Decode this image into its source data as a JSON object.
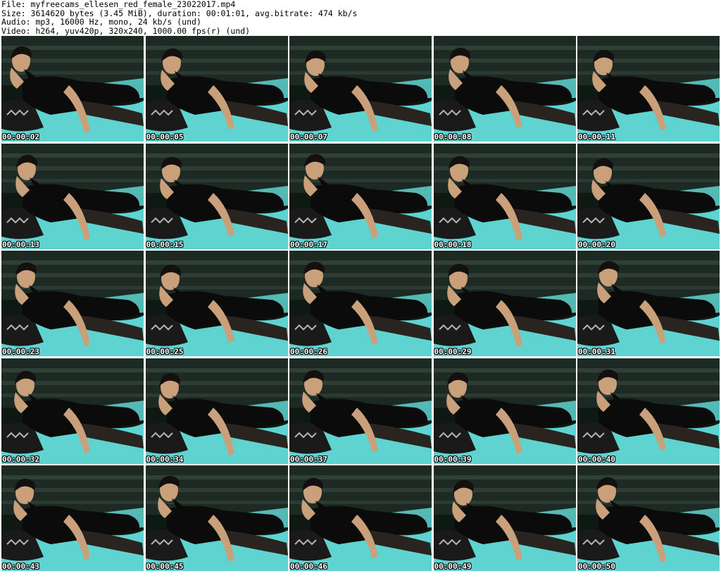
{
  "header": {
    "file_line": "File: myfreecams_ellesen_red_female_23022017.mp4",
    "size_line": "Size: 3614620 bytes (3.45 MiB), duration: 00:01:01, avg.bitrate: 474 kb/s",
    "audio_line": "Audio: mp3, 16000 Hz, mono, 24 kb/s (und)",
    "video_line": "Video: h264, yuv420p, 320x240, 1000.00 fps(r) (und)"
  },
  "colors": {
    "sheet": "#5fd3d0",
    "headboard": "#1d2a24",
    "slat": "#3a4a40",
    "dress": "#0b0b0b",
    "skin": "#c9a07a",
    "hair": "#141010",
    "stocking": "#2a2420",
    "pillow": "#1a1a1a"
  },
  "frames": [
    {
      "timestamp": "00:00:02"
    },
    {
      "timestamp": "00:00:05"
    },
    {
      "timestamp": "00:00:07"
    },
    {
      "timestamp": "00:00:08"
    },
    {
      "timestamp": "00:00:11"
    },
    {
      "timestamp": "00:00:13"
    },
    {
      "timestamp": "00:00:15"
    },
    {
      "timestamp": "00:00:17"
    },
    {
      "timestamp": "00:00:18"
    },
    {
      "timestamp": "00:00:20"
    },
    {
      "timestamp": "00:00:23"
    },
    {
      "timestamp": "00:00:25"
    },
    {
      "timestamp": "00:00:26"
    },
    {
      "timestamp": "00:00:29"
    },
    {
      "timestamp": "00:00:31"
    },
    {
      "timestamp": "00:00:32"
    },
    {
      "timestamp": "00:00:34"
    },
    {
      "timestamp": "00:00:37"
    },
    {
      "timestamp": "00:00:39"
    },
    {
      "timestamp": "00:00:40"
    },
    {
      "timestamp": "00:00:43"
    },
    {
      "timestamp": "00:00:45"
    },
    {
      "timestamp": "00:00:46"
    },
    {
      "timestamp": "00:00:49"
    },
    {
      "timestamp": "00:00:50"
    }
  ]
}
